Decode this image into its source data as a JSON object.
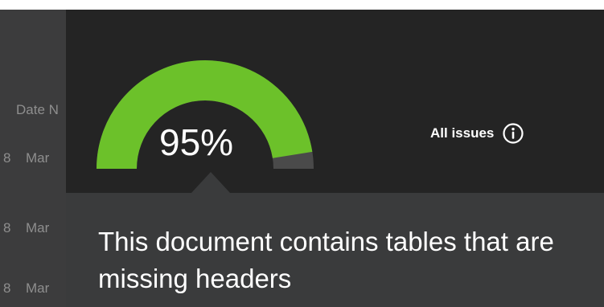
{
  "table": {
    "header": "Date N",
    "rows": [
      {
        "num": "8",
        "month": "Mar"
      },
      {
        "num": "8",
        "month": "Mar"
      },
      {
        "num": "8",
        "month": "Mar"
      }
    ]
  },
  "gauge": {
    "percent_label": "95%",
    "value": 0.95,
    "fill_color": "#6cc12a",
    "track_color": "#4a4a4a"
  },
  "issues": {
    "label": "All issues",
    "icon": "info-icon"
  },
  "tooltip": {
    "message": "This document contains tables that are missing headers"
  },
  "colors": {
    "background": "#242424",
    "panel": "#3a3b3c",
    "text": "#ffffff"
  }
}
